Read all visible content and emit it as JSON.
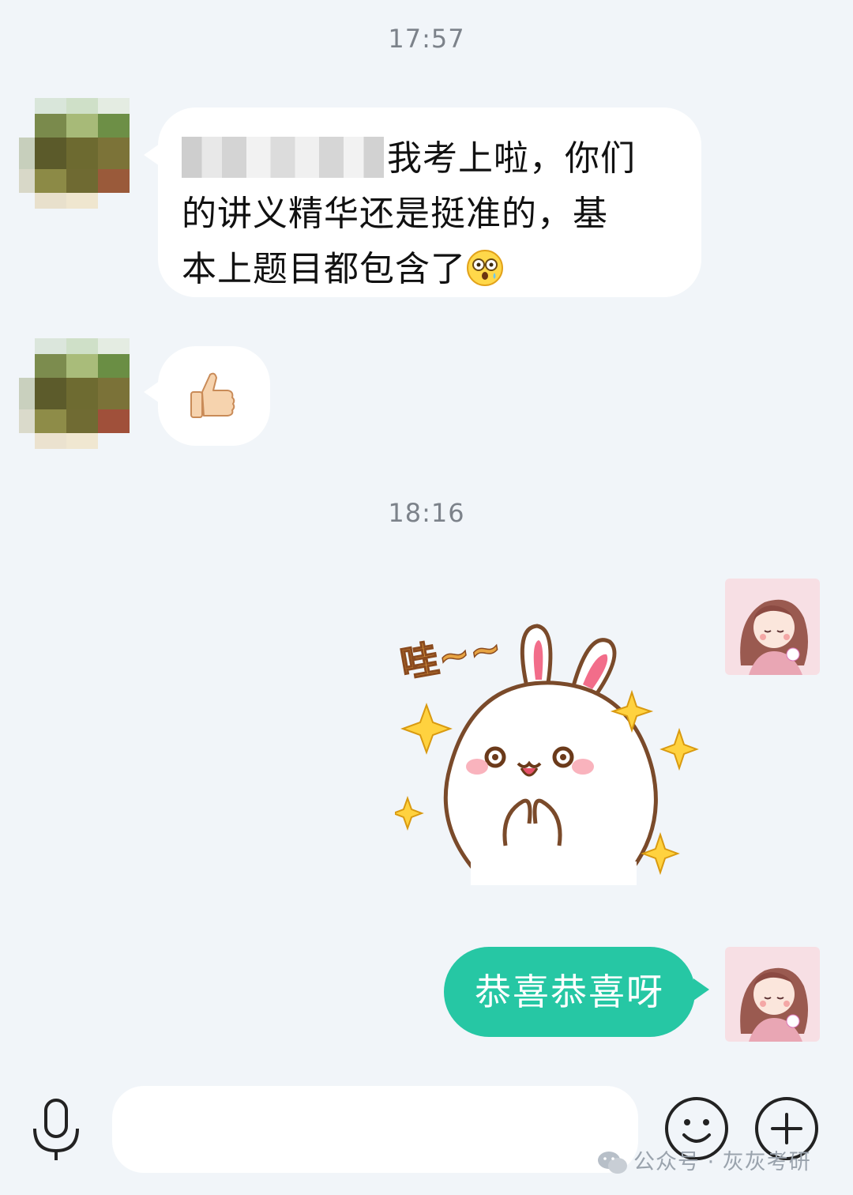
{
  "timestamps": [
    "17:57",
    "18:16"
  ],
  "messages": {
    "incoming_1": {
      "line1_visible": "我考上啦，你们",
      "line2": "的讲义精华还是挺准的，基",
      "line3": "本上题目都包含了",
      "emoji": "astonished-face-emoji"
    },
    "incoming_2": {
      "emoji_text": "👍🏻",
      "emoji": "thumbs-up-emoji"
    },
    "outgoing_sticker": {
      "caption": "哇~~",
      "icon": "rabbit-sticker"
    },
    "outgoing_text": "恭喜恭喜呀"
  },
  "input_bar": {
    "placeholder": "",
    "icons": [
      "microphone-icon",
      "smiley-icon",
      "plus-icon"
    ]
  },
  "watermark": {
    "text": "公众号 · 灰灰考研",
    "icon": "wechat-icon"
  },
  "colors": {
    "background": "#f1f5f9",
    "incoming_bubble": "#ffffff",
    "outgoing_bubble": "#26c7a4",
    "timestamp": "#7c828a"
  }
}
